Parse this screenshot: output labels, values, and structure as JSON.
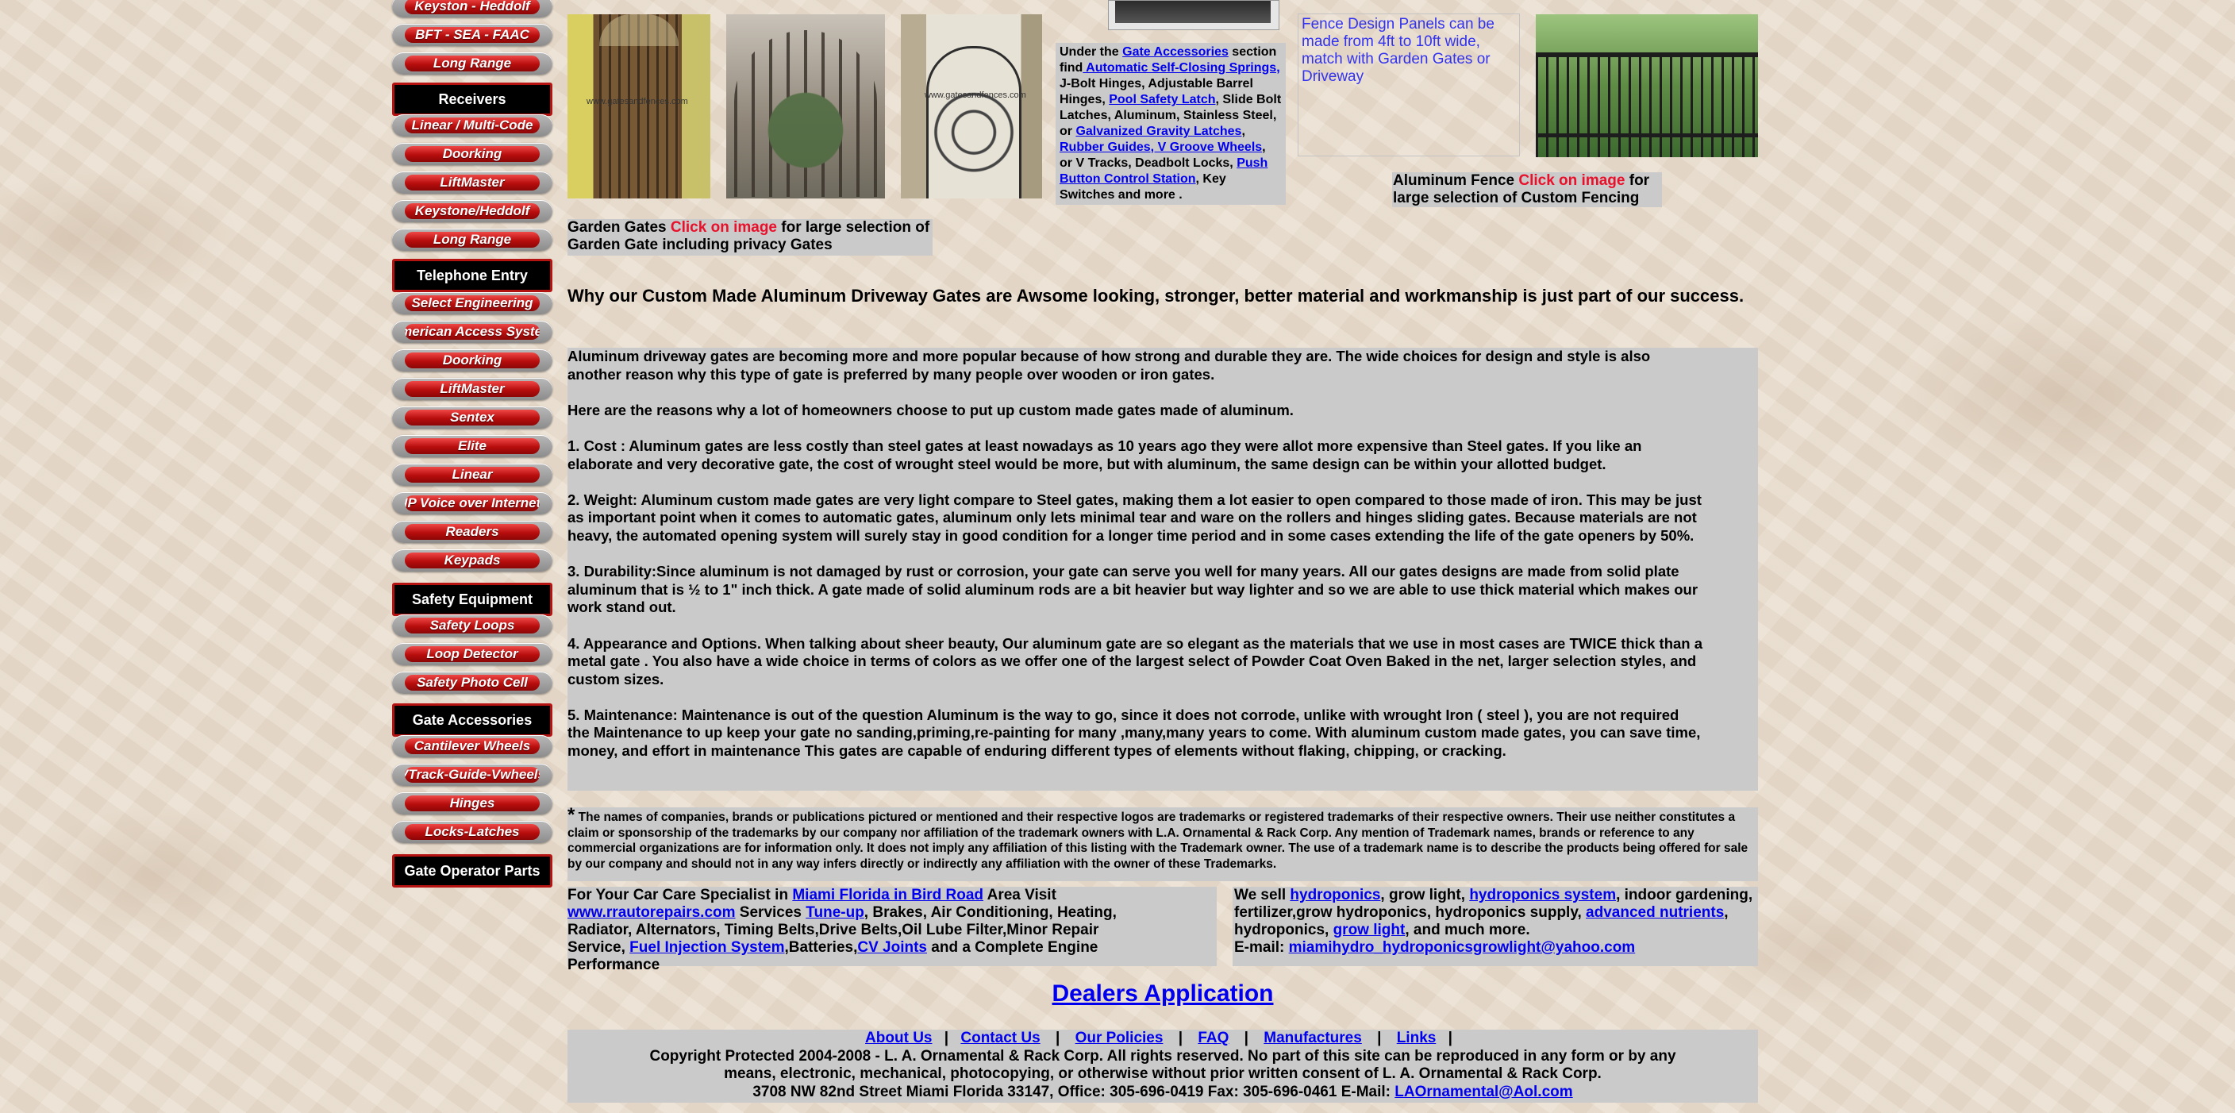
{
  "sidebar": {
    "items": [
      {
        "label": "Keyston - Heddolf",
        "type": "button"
      },
      {
        "label": "BFT - SEA - FAAC",
        "type": "button"
      },
      {
        "label": "Long Range",
        "type": "button"
      },
      {
        "label": "Receivers",
        "type": "header"
      },
      {
        "label": "Linear / Multi-Code",
        "type": "button"
      },
      {
        "label": "Doorking",
        "type": "button"
      },
      {
        "label": "LiftMaster",
        "type": "button"
      },
      {
        "label": "Keystone/Heddolf",
        "type": "button"
      },
      {
        "label": "Long Range",
        "type": "button"
      },
      {
        "label": "Telephone Entry",
        "type": "header"
      },
      {
        "label": "Select Engineering",
        "type": "button"
      },
      {
        "label": "American Access System",
        "type": "button"
      },
      {
        "label": "Doorking",
        "type": "button"
      },
      {
        "label": "LiftMaster",
        "type": "button"
      },
      {
        "label": "Sentex",
        "type": "button"
      },
      {
        "label": "Elite",
        "type": "button"
      },
      {
        "label": "Linear",
        "type": "button"
      },
      {
        "label": "IP Voice over Internet",
        "type": "button"
      },
      {
        "label": "Readers",
        "type": "button"
      },
      {
        "label": "Keypads",
        "type": "button"
      },
      {
        "label": "Safety Equipment",
        "type": "header"
      },
      {
        "label": "Safety Loops",
        "type": "button"
      },
      {
        "label": "Loop Detector",
        "type": "button"
      },
      {
        "label": "Safety Photo Cell",
        "type": "button"
      },
      {
        "label": "Gate Accessories",
        "type": "header"
      },
      {
        "label": "Cantilever Wheels",
        "type": "button"
      },
      {
        "label": "VTrack-Guide-Vwheels",
        "type": "button"
      },
      {
        "label": "Hinges",
        "type": "button"
      },
      {
        "label": "Locks-Latches",
        "type": "button"
      },
      {
        "label": "Gate Operator Parts",
        "type": "header"
      }
    ]
  },
  "top": {
    "photo_watermark_1": "www.gatesandfences.com",
    "photo_watermark_3": "www.gatesandfences.com",
    "accessories": {
      "t1": "Under the ",
      "l1": "Gate Accessories",
      "t2": " section find",
      "l2": " Automatic Self-Closing Springs,",
      "t3": " J-Bolt Hinges, Adjustable Barrel Hinges,  ",
      "l3": "Pool Safety Latch",
      "t4": ", Slide Bolt Latches, Aluminum, Stainless Steel, or ",
      "l4": "Galvanized Gravity Latches",
      "t5": ", ",
      "l5": "Rubber Guides, V Groove Wheels",
      "t6": ", or V Tracks, Deadbolt Locks, ",
      "l6": "Push Button Control Station",
      "t7": ", Key Switches and more ."
    },
    "fence_alt": "Fence Design Panels can be made from 4ft to 10ft wide, match with Garden Gates or Driveway",
    "garden": {
      "t1": "Garden Gates ",
      "click": "Click on image",
      "t2": " for large selection of Garden Gate including privacy Gates"
    },
    "fence_caption": {
      "t1": "Aluminum Fence ",
      "click": "Click on image",
      "t2": " for large selection of Custom Fencing"
    }
  },
  "headline": "Why our Custom Made Aluminum Driveway Gates are Awsome looking, stronger, better material and workmanship is just part of our success.",
  "article": {
    "p1": "Aluminum driveway gates are becoming more and more popular because of how strong and durable they are. The wide choices for design and style is also another reason why this type of gate is preferred by many people over wooden or iron gates.",
    "p2": "Here are the reasons why a lot of homeowners choose to put up custom made gates made of aluminum.",
    "p3": "1. Cost : Aluminum gates are less costly than steel gates at least nowadays as 10 years ago they were allot more expensive than Steel gates. If you like an elaborate and very decorative gate, the cost of wrought steel would be more, but with aluminum, the same design can be within your allotted budget.",
    "p4": "2. Weight: Aluminum custom made gates are very light compare to Steel gates, making them a lot easier to open compared to those made of iron. This may be just as important point when it comes to automatic gates, aluminum only lets minimal tear and ware on the rollers and hinges sliding gates. Because materials are not heavy, the automated opening system will surely stay in good condition for a longer time period and in some cases extending the life of the gate openers by 50%.",
    "p5": "3. Durability:Since aluminum is not damaged by rust or corrosion, your gate can serve you well for many years. All our gates designs are made from solid plate aluminum that is ½ to 1\" inch thick. A gate made of solid aluminum rods are a bit heavier but way lighter and so we are able to use thick material which makes our work stand out.",
    "p6": "4. Appearance and Options. When talking about sheer beauty, Our aluminum gate are so elegant as the materials that we use in most cases are TWICE thick than a metal gate . You also have a wide choice in terms of colors as we offer one of the largest select of Powder Coat Oven Baked in the net, larger selection styles, and custom sizes.",
    "p7": "5. Maintenance: Maintenance is out of the question Aluminum is the way to go, since it does not corrode, unlike with wrought Iron ( steel ), you are not required the Maintenance to up keep your gate no sanding,priming,re-painting for many ,many,many years to come. With aluminum custom made gates, you can save time, money, and effort in maintenance This gates are capable of enduring different types of elements without flaking, chipping, or cracking."
  },
  "trademark": {
    "star": "*",
    "text": " The names of companies, brands or publications pictured or mentioned and their respective logos are trademarks or registered trademarks of their respective owners. Their use neither constitutes a claim or sponsorship of the trademarks by our company nor affiliation of the trademark owners with L.A. Ornamental & Rack Corp. Any mention of Trademark names, brands or reference to any commercial organizations are for information only. It does not imply any affiliation of this listing with the Trademark owner. The use of a trademark name is to describe the products being offered for sale by our company and should not in any way infers directly or indirectly any affiliation with the owner of these Trademarks."
  },
  "car_ad": {
    "t1": "For Your Car Care Specialist in ",
    "l1": "Miami Florida in Bird Road",
    "t2": " Area Visit ",
    "l2": "www.rrautorepairs.com",
    "t3": " Services ",
    "l3": "Tune-up",
    "t4": ", Brakes, Air Conditioning,  Heating, Radiator, Alternators, Timing Belts,Drive Belts,Oil Lube Filter,Minor Repair Service, ",
    "l4": "Fuel Injection System",
    "t5": ",Batteries,",
    "l5": "CV Joints",
    "t6": " and a Complete Engine Performance"
  },
  "hydro_ad": {
    "t1": "We sell ",
    "l1": "hydroponics",
    "t2": ", grow light, ",
    "l2": "hydroponics system",
    "t3": ", indoor gardening, fertilizer,grow hydroponics, hydroponics supply, ",
    "l3": "advanced nutrients",
    "t4": ", hydroponics, ",
    "l4": "grow light",
    "t5": ", and much more.",
    "t6": "E-mail: ",
    "l6": "miamihydro_hydroponicsgrowlight@yahoo.com"
  },
  "dealers": "Dealers Application",
  "footer": {
    "links": [
      "About Us",
      "Contact Us",
      "Our Policies",
      "FAQ",
      "Manufactures",
      "Links"
    ],
    "sep": "|",
    "copyright": "Copyright Protected 2004-2008 - L. A. Ornamental & Rack Corp.  All rights reserved. No part of this site can be reproduced in any form or by any means, electronic, mechanical, photocopying, or otherwise without prior written consent of L. A. Ornamental & Rack Corp.",
    "address": "3708 NW 82nd Street  Miami  Florida  33147, Office: 305-696-0419  Fax: 305-696-0461 E-Mail: ",
    "email": "LAOrnamental@Aol.com"
  }
}
